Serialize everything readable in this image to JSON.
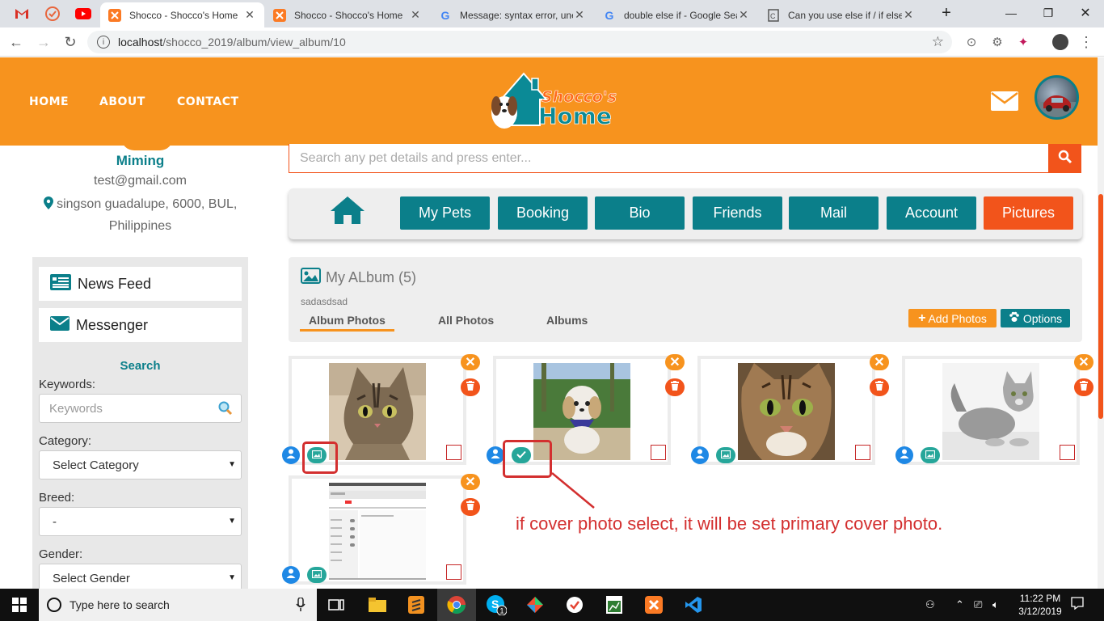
{
  "browser": {
    "tabs": [
      {
        "title": "Shocco - Shocco's Home",
        "active": true
      },
      {
        "title": "Shocco - Shocco's Home",
        "active": false
      },
      {
        "title": "Message: syntax error, une",
        "active": false
      },
      {
        "title": "double else if - Google Sea",
        "active": false
      },
      {
        "title": "Can you use else if / if else",
        "active": false
      }
    ],
    "url_host": "localhost",
    "url_path": "/shocco_2019/album/view_album/10"
  },
  "site": {
    "nav": [
      "HOME",
      "ABOUT",
      "CONTACT"
    ],
    "logo_line1": "Shocco's",
    "logo_line2": "Home"
  },
  "profile": {
    "name": "Miming",
    "email": "test@gmail.com",
    "address_line1": "singson guadalupe, 6000, BUL,",
    "address_line2": "Philippines"
  },
  "sidebar": {
    "news_feed": "News Feed",
    "messenger": "Messenger",
    "search_title": "Search",
    "keywords_label": "Keywords:",
    "keywords_placeholder": "Keywords",
    "category_label": "Category:",
    "category_value": "Select Category",
    "breed_label": "Breed:",
    "breed_value": "-",
    "gender_label": "Gender:",
    "gender_value": "Select Gender"
  },
  "main": {
    "search_placeholder": "Search any pet details and press enter...",
    "menu": [
      "My Pets",
      "Booking",
      "Bio",
      "Friends",
      "Mail",
      "Account",
      "Pictures"
    ],
    "active_menu": "Pictures",
    "album_title": "My ALbum (5)",
    "album_desc": "sadasdsad",
    "album_tabs": [
      "Album Photos",
      "All Photos",
      "Albums"
    ],
    "add_photos": "Add Photos",
    "options": "Options",
    "photos": [
      {
        "subject": "tabby cat",
        "is_cover": false
      },
      {
        "subject": "shih tzu dog",
        "is_cover": true
      },
      {
        "subject": "cat face closeup",
        "is_cover": false
      },
      {
        "subject": "grey fluffy cat",
        "is_cover": false
      },
      {
        "subject": "screenshot",
        "is_cover": false
      }
    ],
    "annotation": "if cover photo select, it will be set primary cover photo."
  },
  "taskbar": {
    "search_text": "Type here to search",
    "time": "11:22 PM",
    "date": "3/12/2019"
  },
  "colors": {
    "orange": "#f7931e",
    "red": "#f2541b",
    "teal": "#0b7f8a"
  }
}
